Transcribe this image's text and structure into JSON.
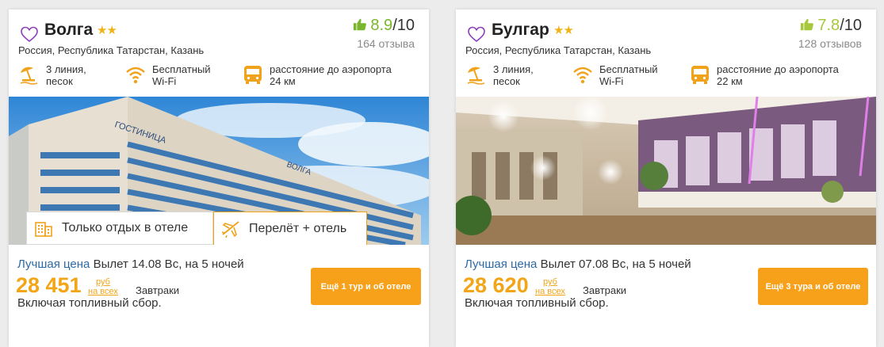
{
  "hotels": [
    {
      "name": "Волга",
      "stars": "★★",
      "location": "Россия, Республика Татарстан, Казань",
      "rating": {
        "score": "8.9",
        "scale": "/10",
        "reviews": "164 отзыва"
      },
      "features": [
        {
          "icon": "beach-umbrella-icon",
          "line1": "3 линия,",
          "line2": "песок"
        },
        {
          "icon": "wifi-icon",
          "line1": "Бесплатный",
          "line2": "Wi-Fi"
        },
        {
          "icon": "bus-icon",
          "line1": "расстояние до аэропорта",
          "line2": "24 км"
        }
      ],
      "photo": {
        "sign_text": "ГОСТИНИЦА",
        "logo_text": "ВОЛГА"
      },
      "tabs": [
        {
          "icon": "building-icon",
          "label": "Только отдых в отеле"
        },
        {
          "icon": "airplane-icon",
          "label": "Перелёт + отель",
          "active": true
        }
      ],
      "best_price_label": "Лучшая цена",
      "departure": "Вылет 14.08 Вс, на 5 ночей",
      "price": "28 451",
      "currency": "руб",
      "per": "на всех",
      "meal": "Завтраки",
      "fuel": "Включая топливный сбор.",
      "button": "Ещё 1 тур и об отеле"
    },
    {
      "name": "Булгар",
      "stars": "★★",
      "location": "Россия, Республика Татарстан, Казань",
      "rating": {
        "score": "7.8",
        "scale": "/10",
        "reviews": "128 отзывов"
      },
      "features": [
        {
          "icon": "beach-umbrella-icon",
          "line1": "3 линия,",
          "line2": "песок"
        },
        {
          "icon": "wifi-icon",
          "line1": "Бесплатный",
          "line2": "Wi-Fi"
        },
        {
          "icon": "bus-icon",
          "line1": "расстояние до аэропорта",
          "line2": "22 км"
        }
      ],
      "best_price_label": "Лучшая цена",
      "departure": "Вылет 07.08 Вс, на 5 ночей",
      "price": "28 620",
      "currency": "руб",
      "per": "на всех",
      "meal": "Завтраки",
      "fuel": "Включая топливный сбор.",
      "button": "Ещё 3 тура и об отеле"
    }
  ],
  "colors": {
    "accent": "#f7a01a",
    "rating_good": "#79b62c",
    "star": "#f0b31a",
    "heart": "#8b3fb8",
    "link": "#2c6aa6"
  }
}
